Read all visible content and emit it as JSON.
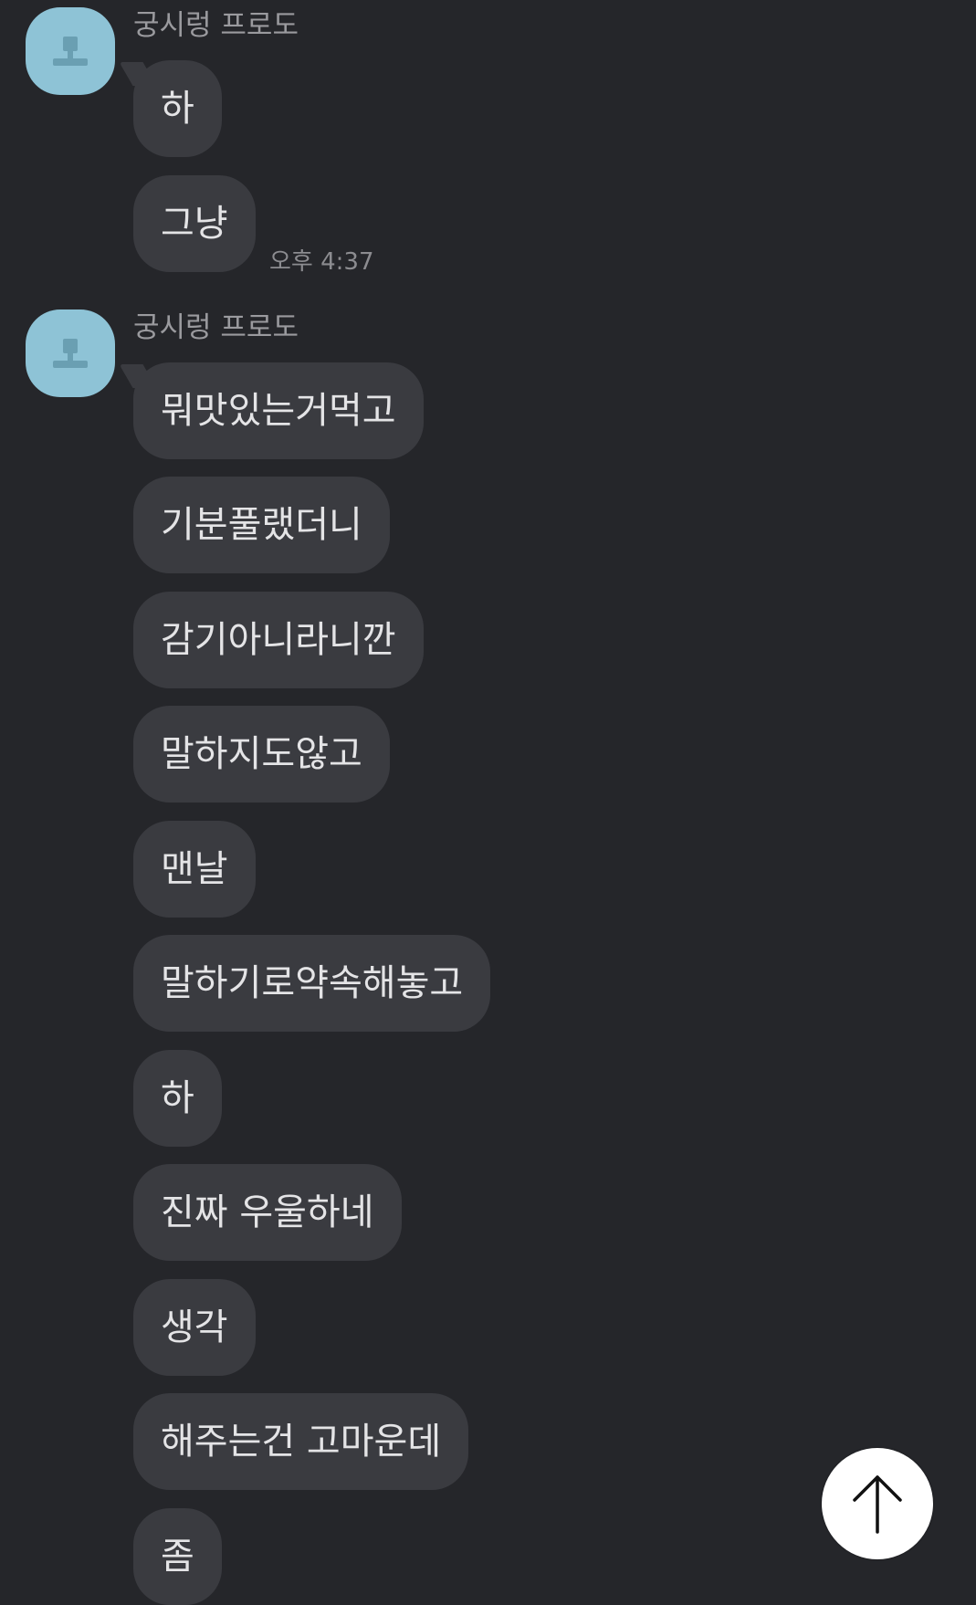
{
  "groups": [
    {
      "sender": "궁시렁 프로도",
      "avatar_icon": "person-silhouette-icon",
      "messages": [
        "하",
        "그냥"
      ],
      "time": "오후 4:37"
    },
    {
      "sender": "궁시렁 프로도",
      "avatar_icon": "person-silhouette-icon",
      "messages": [
        "뭐맛있는거먹고",
        "기분풀랬더니",
        "감기아니라니깐",
        "말하지도않고",
        "맨날",
        "말하기로약속해놓고",
        "하",
        "진짜 우울하네",
        "생각",
        "해주는건 고마운데",
        "좀"
      ]
    }
  ],
  "scroll_button": {
    "icon": "arrow-up-icon"
  },
  "colors": {
    "background": "#25262a",
    "bubble": "#3a3b40",
    "bubble_text": "#e4e4e6",
    "avatar": "#8ec3d6",
    "meta_text": "#9a9a9e"
  }
}
